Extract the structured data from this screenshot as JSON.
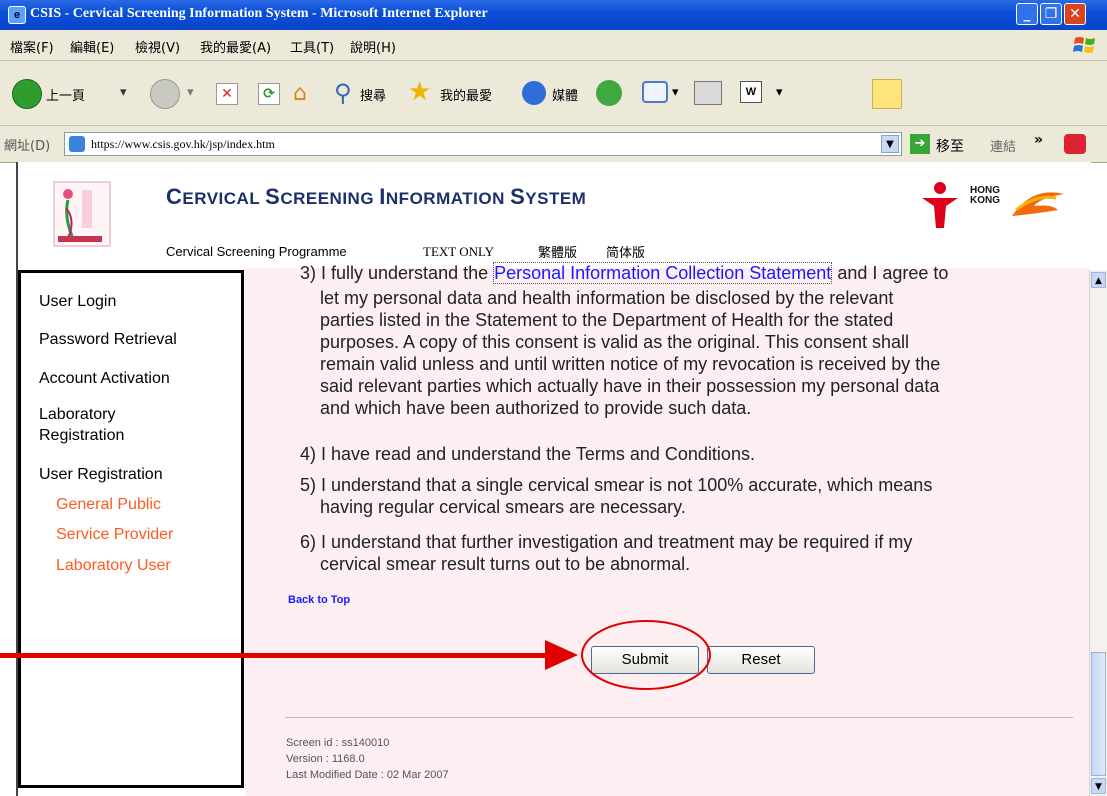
{
  "window": {
    "title": "CSIS - Cervical Screening Information System - Microsoft Internet Explorer"
  },
  "menu": [
    "檔案(F)",
    "編輯(E)",
    "檢視(V)",
    "我的最愛(A)",
    "工具(T)",
    "說明(H)"
  ],
  "toolbar": {
    "back": "上一頁",
    "search": "搜尋",
    "favorites": "我的最愛",
    "media": "媒體"
  },
  "address": {
    "label": "網址(D)",
    "url": "https://www.csis.gov.hk/jsp/index.htm",
    "go": "移至",
    "links": "連結"
  },
  "header": {
    "title_big1": "C",
    "title_small1": "ERVICAL ",
    "title_big2": "S",
    "title_small2": "CREENING ",
    "title_big3": "I",
    "title_small3": "NFORMATION ",
    "title_big4": "S",
    "title_small4": "YSTEM",
    "links": [
      "Cervical Screening Programme",
      "TEXT ONLY",
      "繁體版",
      "简体版"
    ],
    "hk_logo": "HONG KONG"
  },
  "sidebar": {
    "items": [
      "User Login",
      "Password Retrieval",
      "Account Activation",
      "Laboratory Registration",
      "User Registration"
    ],
    "subitems": [
      "General Public",
      "Service Provider",
      "Laboratory User"
    ]
  },
  "content": {
    "p3_prefix": "3) I fully understand the ",
    "p3_link": "Personal Information Collection Statement",
    "p3_suffix": " and I agree to",
    "p3_lines": [
      "let my personal data and health information be disclosed by the relevant",
      "parties listed in the Statement to the Department of Health for the stated",
      "purposes. A copy of this consent is valid as the original. This consent shall",
      "remain valid unless and until written notice of my revocation is received by the",
      "said relevant parties which actually have in their possession my personal data",
      "and which have been authorized to provide such data."
    ],
    "p4": "4) I have read and understand the Terms and Conditions.",
    "p5": [
      "5) I understand that a single cervical smear is not 100% accurate, which means",
      "having regular cervical smears are necessary."
    ],
    "p6": [
      "6) I understand that further investigation and treatment may be required if my",
      "cervical smear result turns out to be abnormal."
    ],
    "back_to_top": "Back to Top",
    "submit": "Submit",
    "reset": "Reset"
  },
  "footer": {
    "screen_id": "Screen id : ss140010",
    "version": "Version : 1168.0",
    "modified": "Last Modified Date : 02 Mar 2007"
  },
  "colors": {
    "title": "#1b2f6b",
    "sublink": "#ff5a1f",
    "content_bg": "#fceef1",
    "annotation": "#e00000"
  }
}
